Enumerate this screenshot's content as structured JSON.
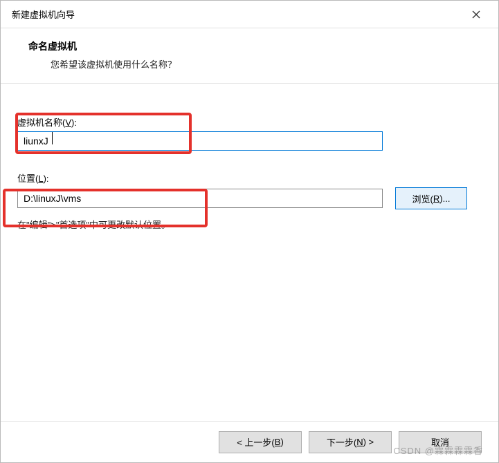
{
  "window": {
    "title": "新建虚拟机向导"
  },
  "header": {
    "title": "命名虚拟机",
    "subtitle": "您希望该虚拟机使用什么名称？"
  },
  "fields": {
    "name": {
      "label_prefix": "虚拟机名称(",
      "label_accel": "V",
      "label_suffix": "):",
      "value": "liunxJ"
    },
    "location": {
      "label_prefix": "位置(",
      "label_accel": "L",
      "label_suffix": "):",
      "value": "D:\\linuxJ\\vms"
    },
    "browse": {
      "prefix": "浏览(",
      "accel": "R",
      "suffix": ")..."
    },
    "hint": "在\"编辑\">\"首选项\"中可更改默认位置。"
  },
  "footer": {
    "back": {
      "pre": "< 上一步(",
      "accel": "B",
      "post": ")"
    },
    "next": {
      "pre": "下一步(",
      "accel": "N",
      "post": ") >"
    },
    "cancel": {
      "text": "取消"
    }
  },
  "watermark": "CSDN @霖霖霖霖香"
}
